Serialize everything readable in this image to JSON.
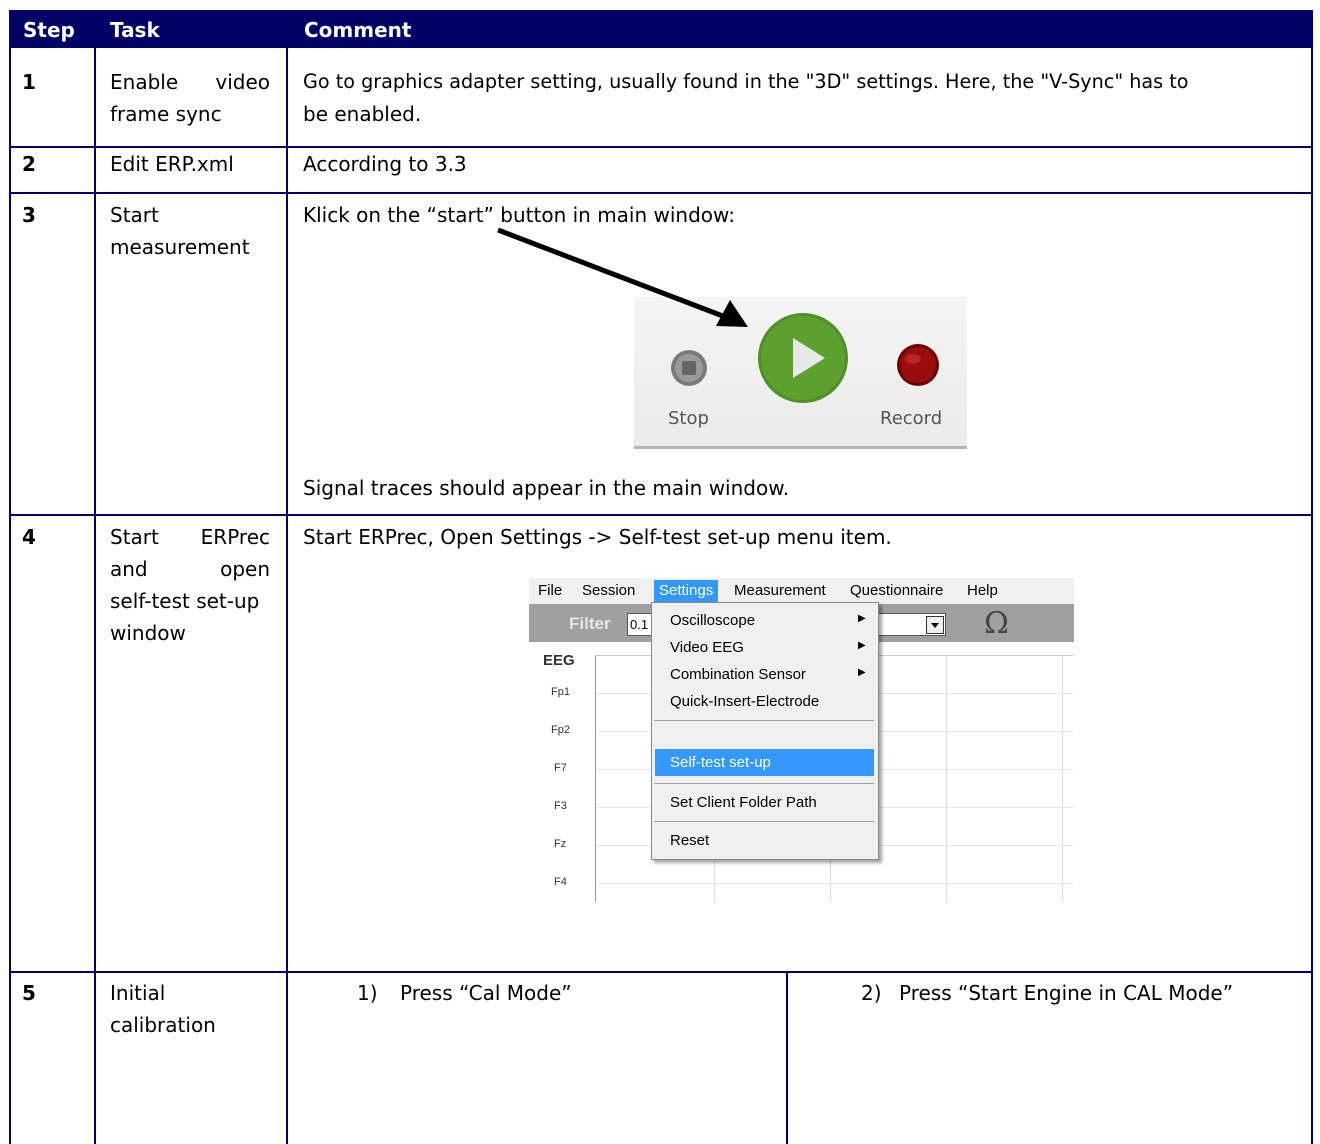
{
  "header": {
    "step": "Step",
    "task": "Task",
    "comment": "Comment"
  },
  "rows": [
    {
      "step": "1",
      "task_lines": [
        "Enable video",
        "frame sync"
      ],
      "comment_lines": [
        "Go to graphics adapter setting, usually found in the \"3D\" settings. Here, the \"V-Sync\" has to",
        "be enabled."
      ]
    },
    {
      "step": "2",
      "task_lines": [
        "Edit ERP.xml"
      ],
      "comment_lines": [
        "According to 3.3"
      ]
    },
    {
      "step": "3",
      "task_lines": [
        "Start",
        "measurement"
      ],
      "comment_lines": [
        "Klick on the “start” button in main window:"
      ],
      "comment_after": "Signal traces should appear in the main window.",
      "controls": {
        "stop": "Stop",
        "record": "Record"
      }
    },
    {
      "step": "4",
      "task_lines": [
        "Start ERPrec",
        "and open",
        "self-test set-up",
        "window"
      ],
      "comment_lines": [
        "Start ERPrec, Open Settings -> Self-test set-up menu item."
      ],
      "screenshot": {
        "menubar": [
          "File",
          "Session",
          "Settings",
          "Measurement",
          "Questionnaire",
          "Help"
        ],
        "filter_label": "Filter",
        "filter_value": "0.1",
        "section": "EEG",
        "channels": [
          "Fp1",
          "Fp2",
          "F7",
          "F3",
          "Fz",
          "F4"
        ],
        "menu_items": [
          "Oscilloscope",
          "Video EEG",
          "Combination Sensor",
          "Quick-Insert-Electrode",
          "Self-test set-up",
          "Set Client Folder Path",
          "Reset"
        ],
        "highlighted_item": "Self-test set-up"
      }
    },
    {
      "step": "5",
      "task_lines": [
        "Initial",
        "calibration"
      ],
      "sub_left": {
        "num": "1)",
        "text": "Press “Cal Mode”"
      },
      "sub_right": {
        "num": "2)",
        "text": "Press “Start Engine in CAL Mode”"
      }
    }
  ],
  "colors": {
    "header_bg": "#000066",
    "border": "#000066",
    "play_green": "#5ca12e",
    "record_red": "#8b0000",
    "menu_highlight": "#3399ff"
  }
}
